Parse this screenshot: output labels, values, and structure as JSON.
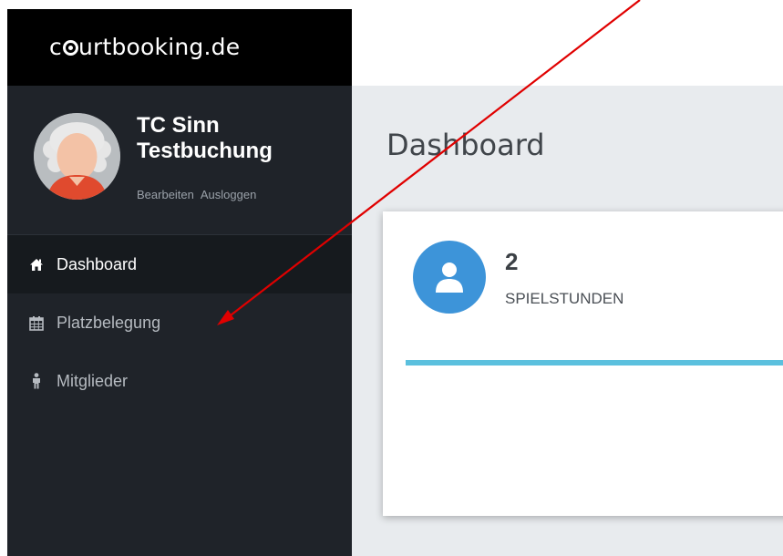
{
  "brand": {
    "prefix": "c",
    "suffix": "urtbooking.de"
  },
  "profile": {
    "name_line1": "TC Sinn",
    "name_line2": "Testbuchung",
    "edit_label": "Bearbeiten",
    "logout_label": "Ausloggen"
  },
  "nav": {
    "items": [
      {
        "label": "Dashboard",
        "icon": "home-icon",
        "active": true
      },
      {
        "label": "Platzbelegung",
        "icon": "calendar-icon",
        "active": false
      },
      {
        "label": "Mitglieder",
        "icon": "person-icon",
        "active": false
      }
    ]
  },
  "main": {
    "title": "Dashboard",
    "stat": {
      "value": "2",
      "label": "SPIELSTUNDEN",
      "icon": "user-icon",
      "progress": 1.0
    }
  },
  "colors": {
    "sidebar_bg": "#1f2329",
    "brand_bg": "#000000",
    "accent_blue": "#3d94d9",
    "progress": "#5bc0de",
    "annotation_arrow": "#e00000"
  }
}
